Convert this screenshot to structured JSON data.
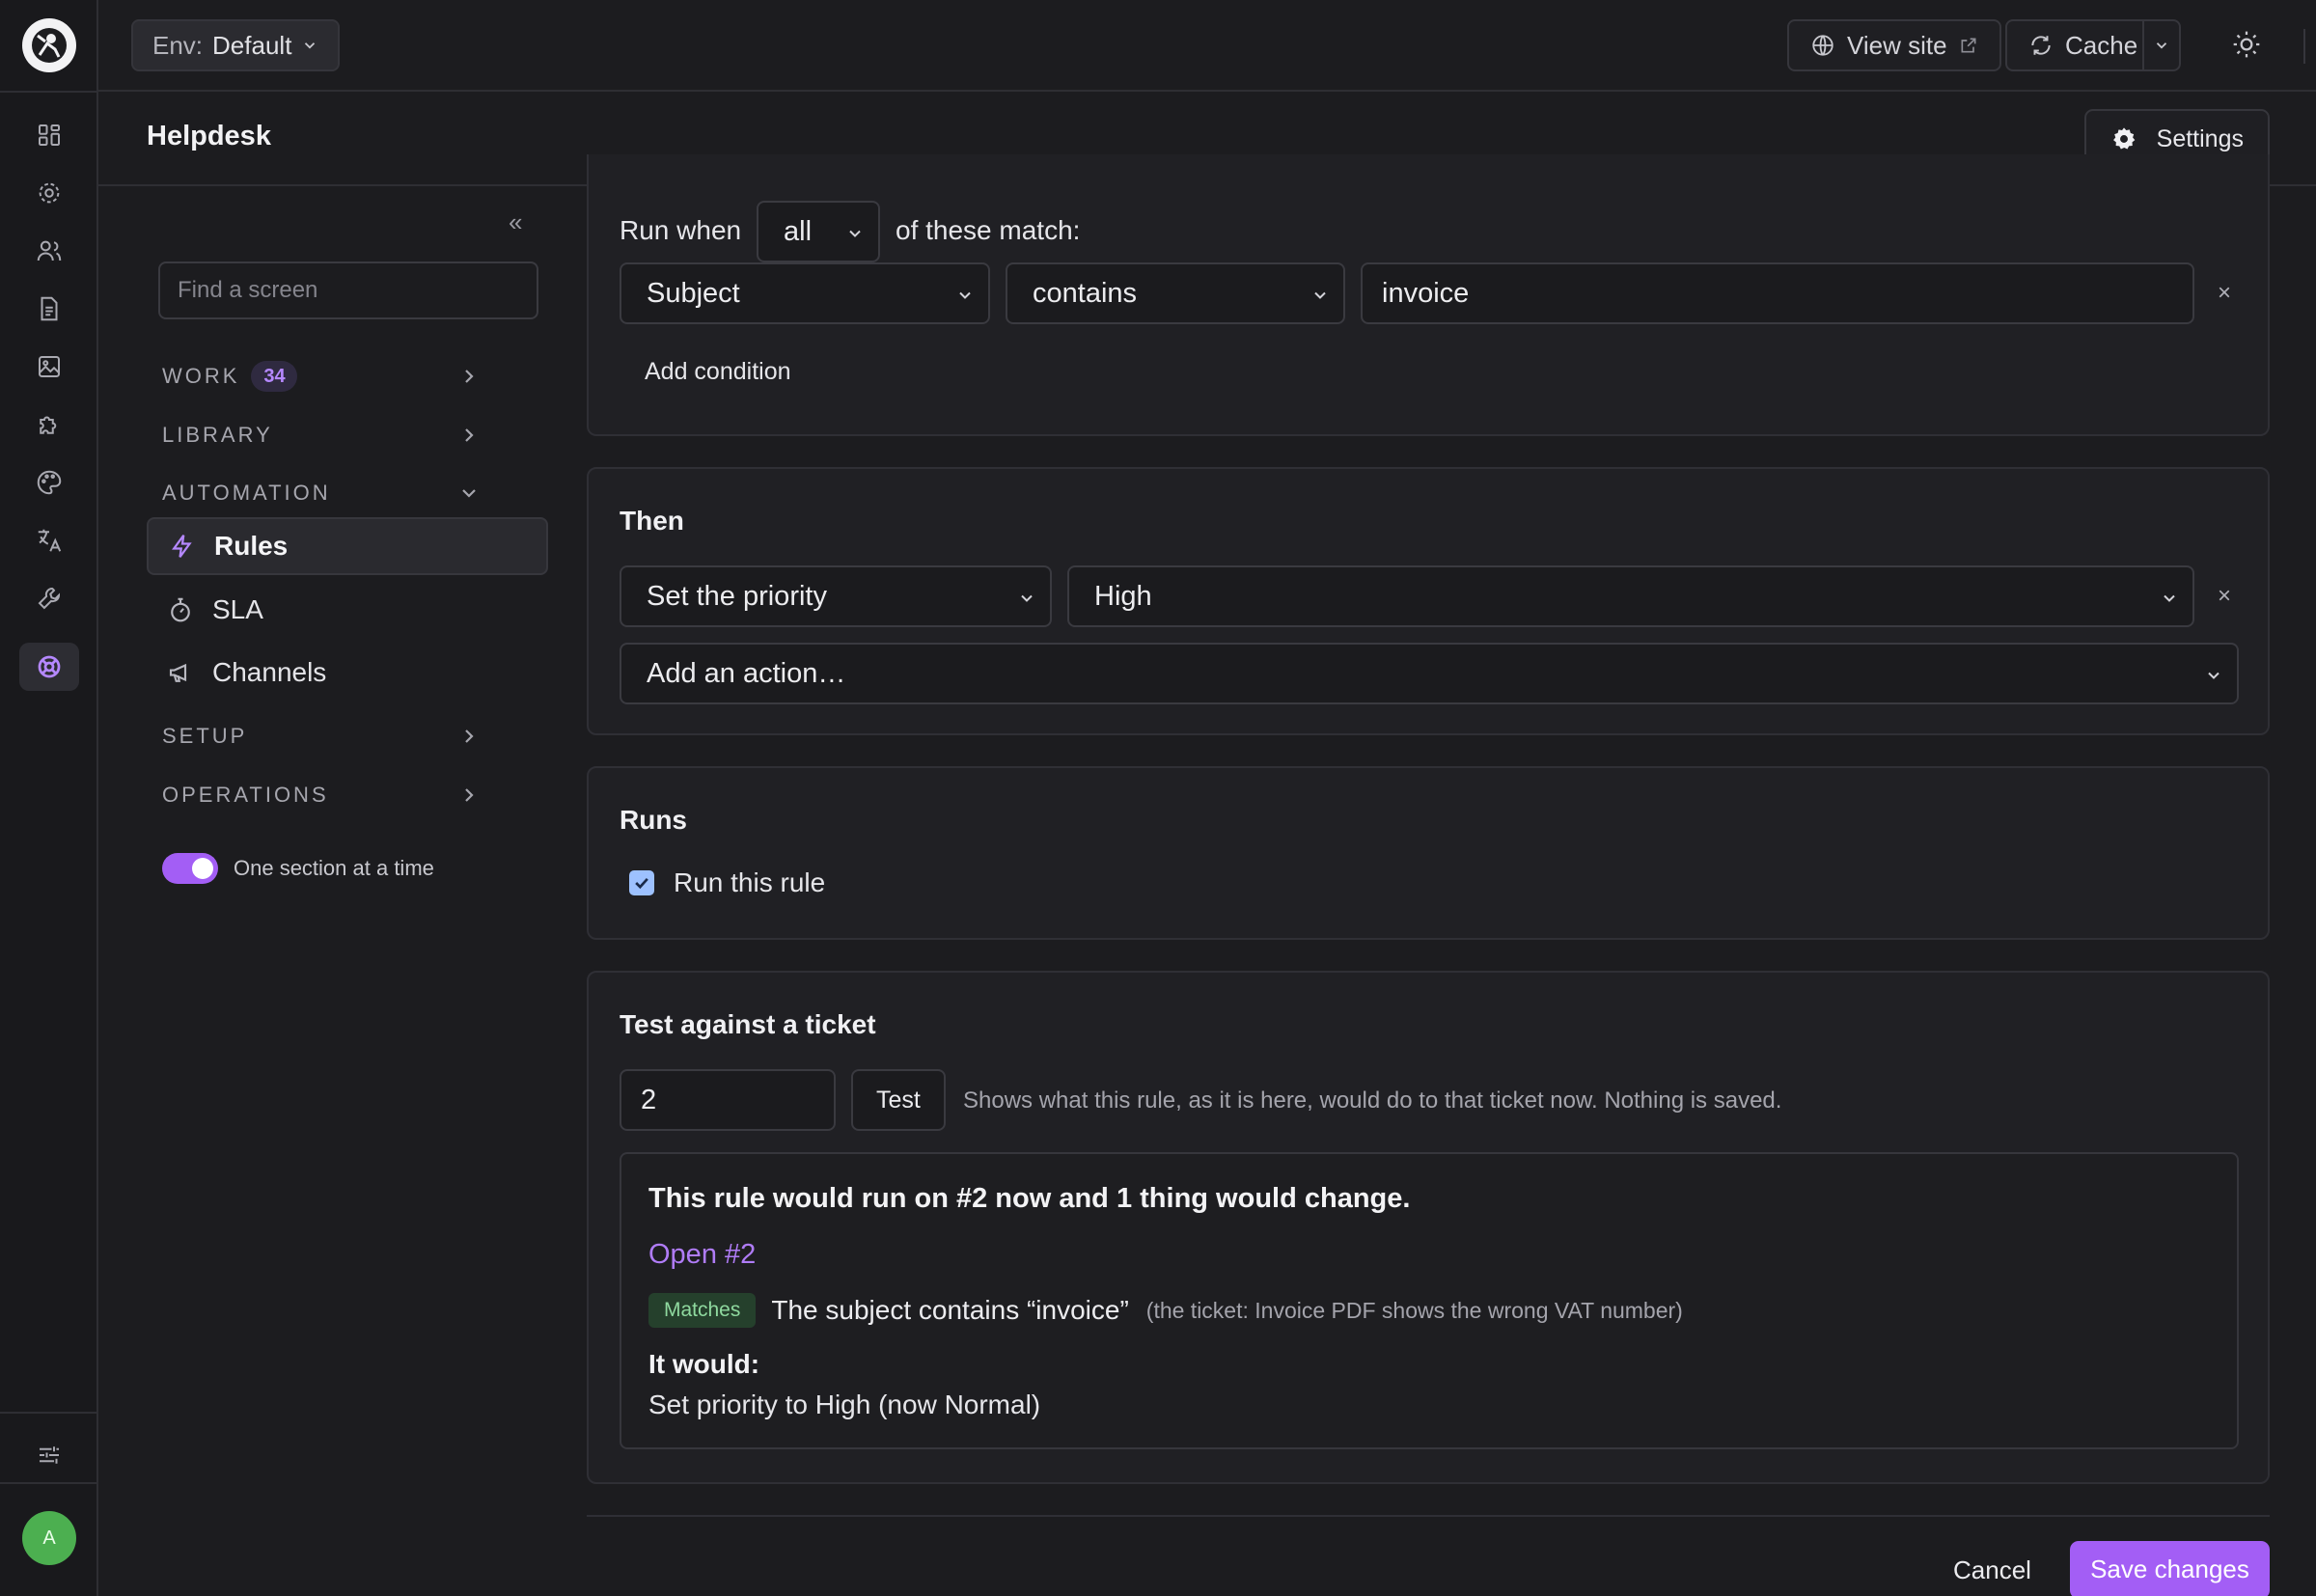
{
  "env": {
    "label": "Env:",
    "value": "Default"
  },
  "topbar": {
    "view_site": "View site",
    "cache": "Cache"
  },
  "header": {
    "title": "Helpdesk",
    "settings": "Settings"
  },
  "sidebar": {
    "search_placeholder": "Find a screen",
    "groups": {
      "work": {
        "label": "WORK",
        "badge": "34"
      },
      "library": {
        "label": "LIBRARY"
      },
      "automation": {
        "label": "AUTOMATION"
      },
      "setup": {
        "label": "SETUP"
      },
      "operations": {
        "label": "OPERATIONS"
      }
    },
    "items": {
      "rules": "Rules",
      "sla": "SLA",
      "channels": "Channels"
    },
    "toggle_label": "One section at a time"
  },
  "when": {
    "run_when": "Run when",
    "match_mode": "all",
    "of_these": "of these match:",
    "field": "Subject",
    "operator": "contains",
    "value": "invoice",
    "add_condition": "Add condition"
  },
  "then": {
    "title": "Then",
    "action": "Set the priority",
    "action_value": "High",
    "add_action": "Add an action…"
  },
  "runs": {
    "title": "Runs",
    "checkbox_label": "Run this rule",
    "checked": true
  },
  "test": {
    "title": "Test against a ticket",
    "ticket_value": "2",
    "button": "Test",
    "hint": "Shows what this rule, as it is here, would do to that ticket now. Nothing is saved.",
    "headline": "This rule would run on #2 now and 1 thing would change.",
    "open_link": "Open #2",
    "chip": "Matches",
    "match_text": "The subject contains “invoice”",
    "match_detail": "(the ticket: Invoice PDF shows the wrong VAT number)",
    "would_label": "It would:",
    "change": "Set priority to High (now Normal)"
  },
  "footer": {
    "cancel": "Cancel",
    "save": "Save changes"
  },
  "user": {
    "initial": "A"
  },
  "colors": {
    "accent": "#a35ef5",
    "link": "#b07cf7",
    "success_chip": "#25402c"
  },
  "icons": {
    "rail": [
      "dashboard-icon",
      "gear-icon",
      "users-icon",
      "document-icon",
      "image-icon",
      "puzzle-icon",
      "palette-icon",
      "translate-icon",
      "wrench-icon",
      "lifebuoy-icon",
      "sliders-icon"
    ]
  }
}
